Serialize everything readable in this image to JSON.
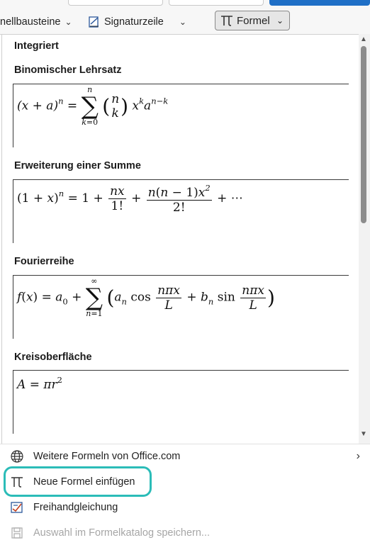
{
  "ribbon": {
    "table_blocks_label": "nellbausteine",
    "signature_label": "Signaturzeile",
    "formula_label": "Formel"
  },
  "gallery": {
    "header": "Integriert",
    "sections": [
      {
        "title": "Binomischer Lehrsatz",
        "equation": "(x + a)^n = Σ_{k=0}^{n} (n k) x^k a^{n−k}"
      },
      {
        "title": "Erweiterung einer Summe",
        "equation": "(1 + x)^n = 1 + nx/1! + n(n − 1)x^2/2! + ⋯"
      },
      {
        "title": "Fourierreihe",
        "equation": "f(x) = a_0 + Σ_{n=1}^{∞} (a_n cos nπx/L + b_n sin nπx/L)"
      },
      {
        "title": "Kreisoberfläche",
        "equation": "A = πr^2"
      }
    ]
  },
  "menu": {
    "more_formulas": "Weitere Formeln von Office.com",
    "insert_new": "Neue Formel einfügen",
    "ink_equation": "Freihandgleichung",
    "save_selection": "Auswahl im Formelkatalog speichern..."
  },
  "colors": {
    "highlight_ring": "#2bbcb8",
    "scroll_thumb": "#8c8c8c"
  }
}
